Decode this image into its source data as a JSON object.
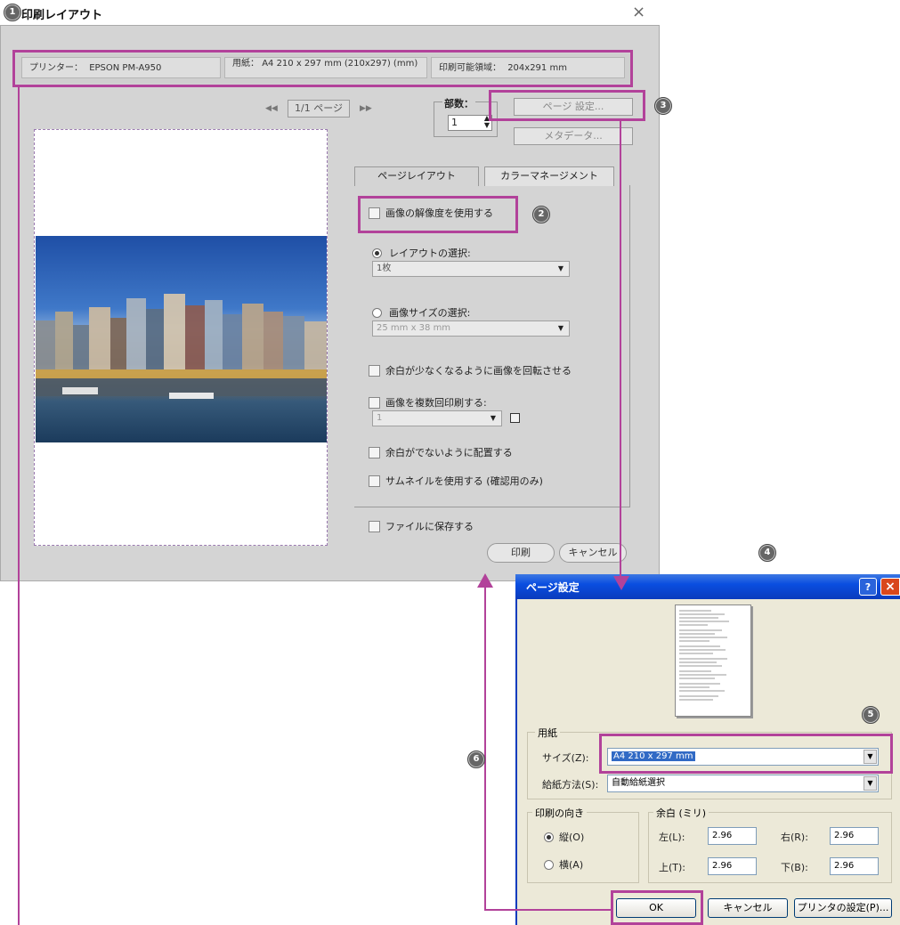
{
  "callouts": [
    "1",
    "2",
    "3",
    "4",
    "5",
    "6"
  ],
  "main": {
    "title": "印刷レイアウト",
    "close_icon": "×",
    "printer_label": "プリンター：",
    "printer_value": "EPSON PM-A950",
    "paper_label": "用紙：",
    "paper_value": "A4 210 x 297 mm (210x297) (mm)",
    "printable_label": "印刷可能領域：",
    "printable_value": "204x291 mm",
    "page_indicator": "1/1 ページ",
    "copies_label": "部数：",
    "copies_value": "1",
    "page_setup_button": "ページ 設定...",
    "metadata_button": "メタデータ...",
    "tabs": [
      "ページレイアウト",
      "カラーマネージメント"
    ],
    "use_resolution": "画像の解像度を使用する",
    "layout_select_label": "レイアウトの選択:",
    "layout_select_value": "1枚",
    "size_select_label": "画像サイズの選択:",
    "size_select_value": "25 mm x 38 mm",
    "rotate_label": "余白が少なくなるように画像を回転させる",
    "multi_label": "画像を複数回印刷する:",
    "multi_value": "1",
    "nomargin_label": "余白がでないように配置する",
    "thumbnail_label": "サムネイルを使用する (確認用のみ)",
    "save_file_label": "ファイルに保存する",
    "print_button": "印刷",
    "cancel_button": "キャンセル"
  },
  "page_setup": {
    "title": "ページ設定",
    "paper_group": "用紙",
    "size_label": "サイズ(Z):",
    "size_value": "A4 210 x 297 mm",
    "source_label": "給紙方法(S):",
    "source_value": "自動給紙選択",
    "orientation_group": "印刷の向き",
    "portrait": "縦(O)",
    "landscape": "横(A)",
    "margins_group": "余白 (ミリ)",
    "left_label": "左(L):",
    "left_value": "2.96",
    "right_label": "右(R):",
    "right_value": "2.96",
    "top_label": "上(T):",
    "top_value": "2.96",
    "bottom_label": "下(B):",
    "bottom_value": "2.96",
    "ok_button": "OK",
    "cancel_button": "キャンセル",
    "printer_button": "プリンタの設定(P)...",
    "help_icon": "?",
    "close_icon": "×"
  },
  "colors": {
    "highlight": "#b2429a",
    "xp_title": "#0a4ee0",
    "dialog_bg": "#d4d4d4",
    "xp_bg": "#ece9d8"
  }
}
